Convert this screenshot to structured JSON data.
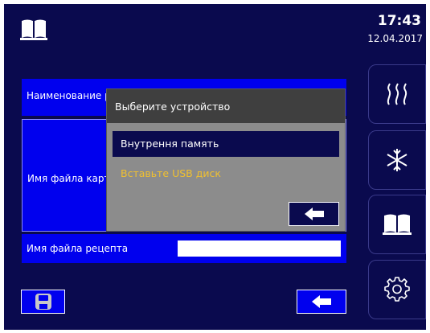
{
  "header": {
    "book_icon": "book-icon",
    "time": "17:43",
    "date": "12.04.2017"
  },
  "sidebar": {
    "items": [
      {
        "icon": "heat-wave-icon"
      },
      {
        "icon": "snowflake-icon"
      },
      {
        "icon": "book-icon"
      },
      {
        "icon": "gear-icon"
      }
    ]
  },
  "form": {
    "name_label": "Наименование р",
    "card_file_label": "Имя файла карт",
    "recipe_file_label": "Имя файла рецепта",
    "recipe_file_value": ""
  },
  "dialog": {
    "title": "Выберите устройство",
    "option_internal": "Внутрення память",
    "option_usb": "Вставьте USB диск",
    "back_icon": "arrow-left-icon"
  },
  "bottom": {
    "save_icon": "floppy-disk-icon",
    "back_icon": "arrow-left-icon"
  },
  "colors": {
    "background": "#0a0a4e",
    "form_blue": "#0000ee",
    "dialog_gray": "#8c8c8c",
    "dialog_header": "#3f3f3f",
    "usb_text": "#f0c030"
  }
}
